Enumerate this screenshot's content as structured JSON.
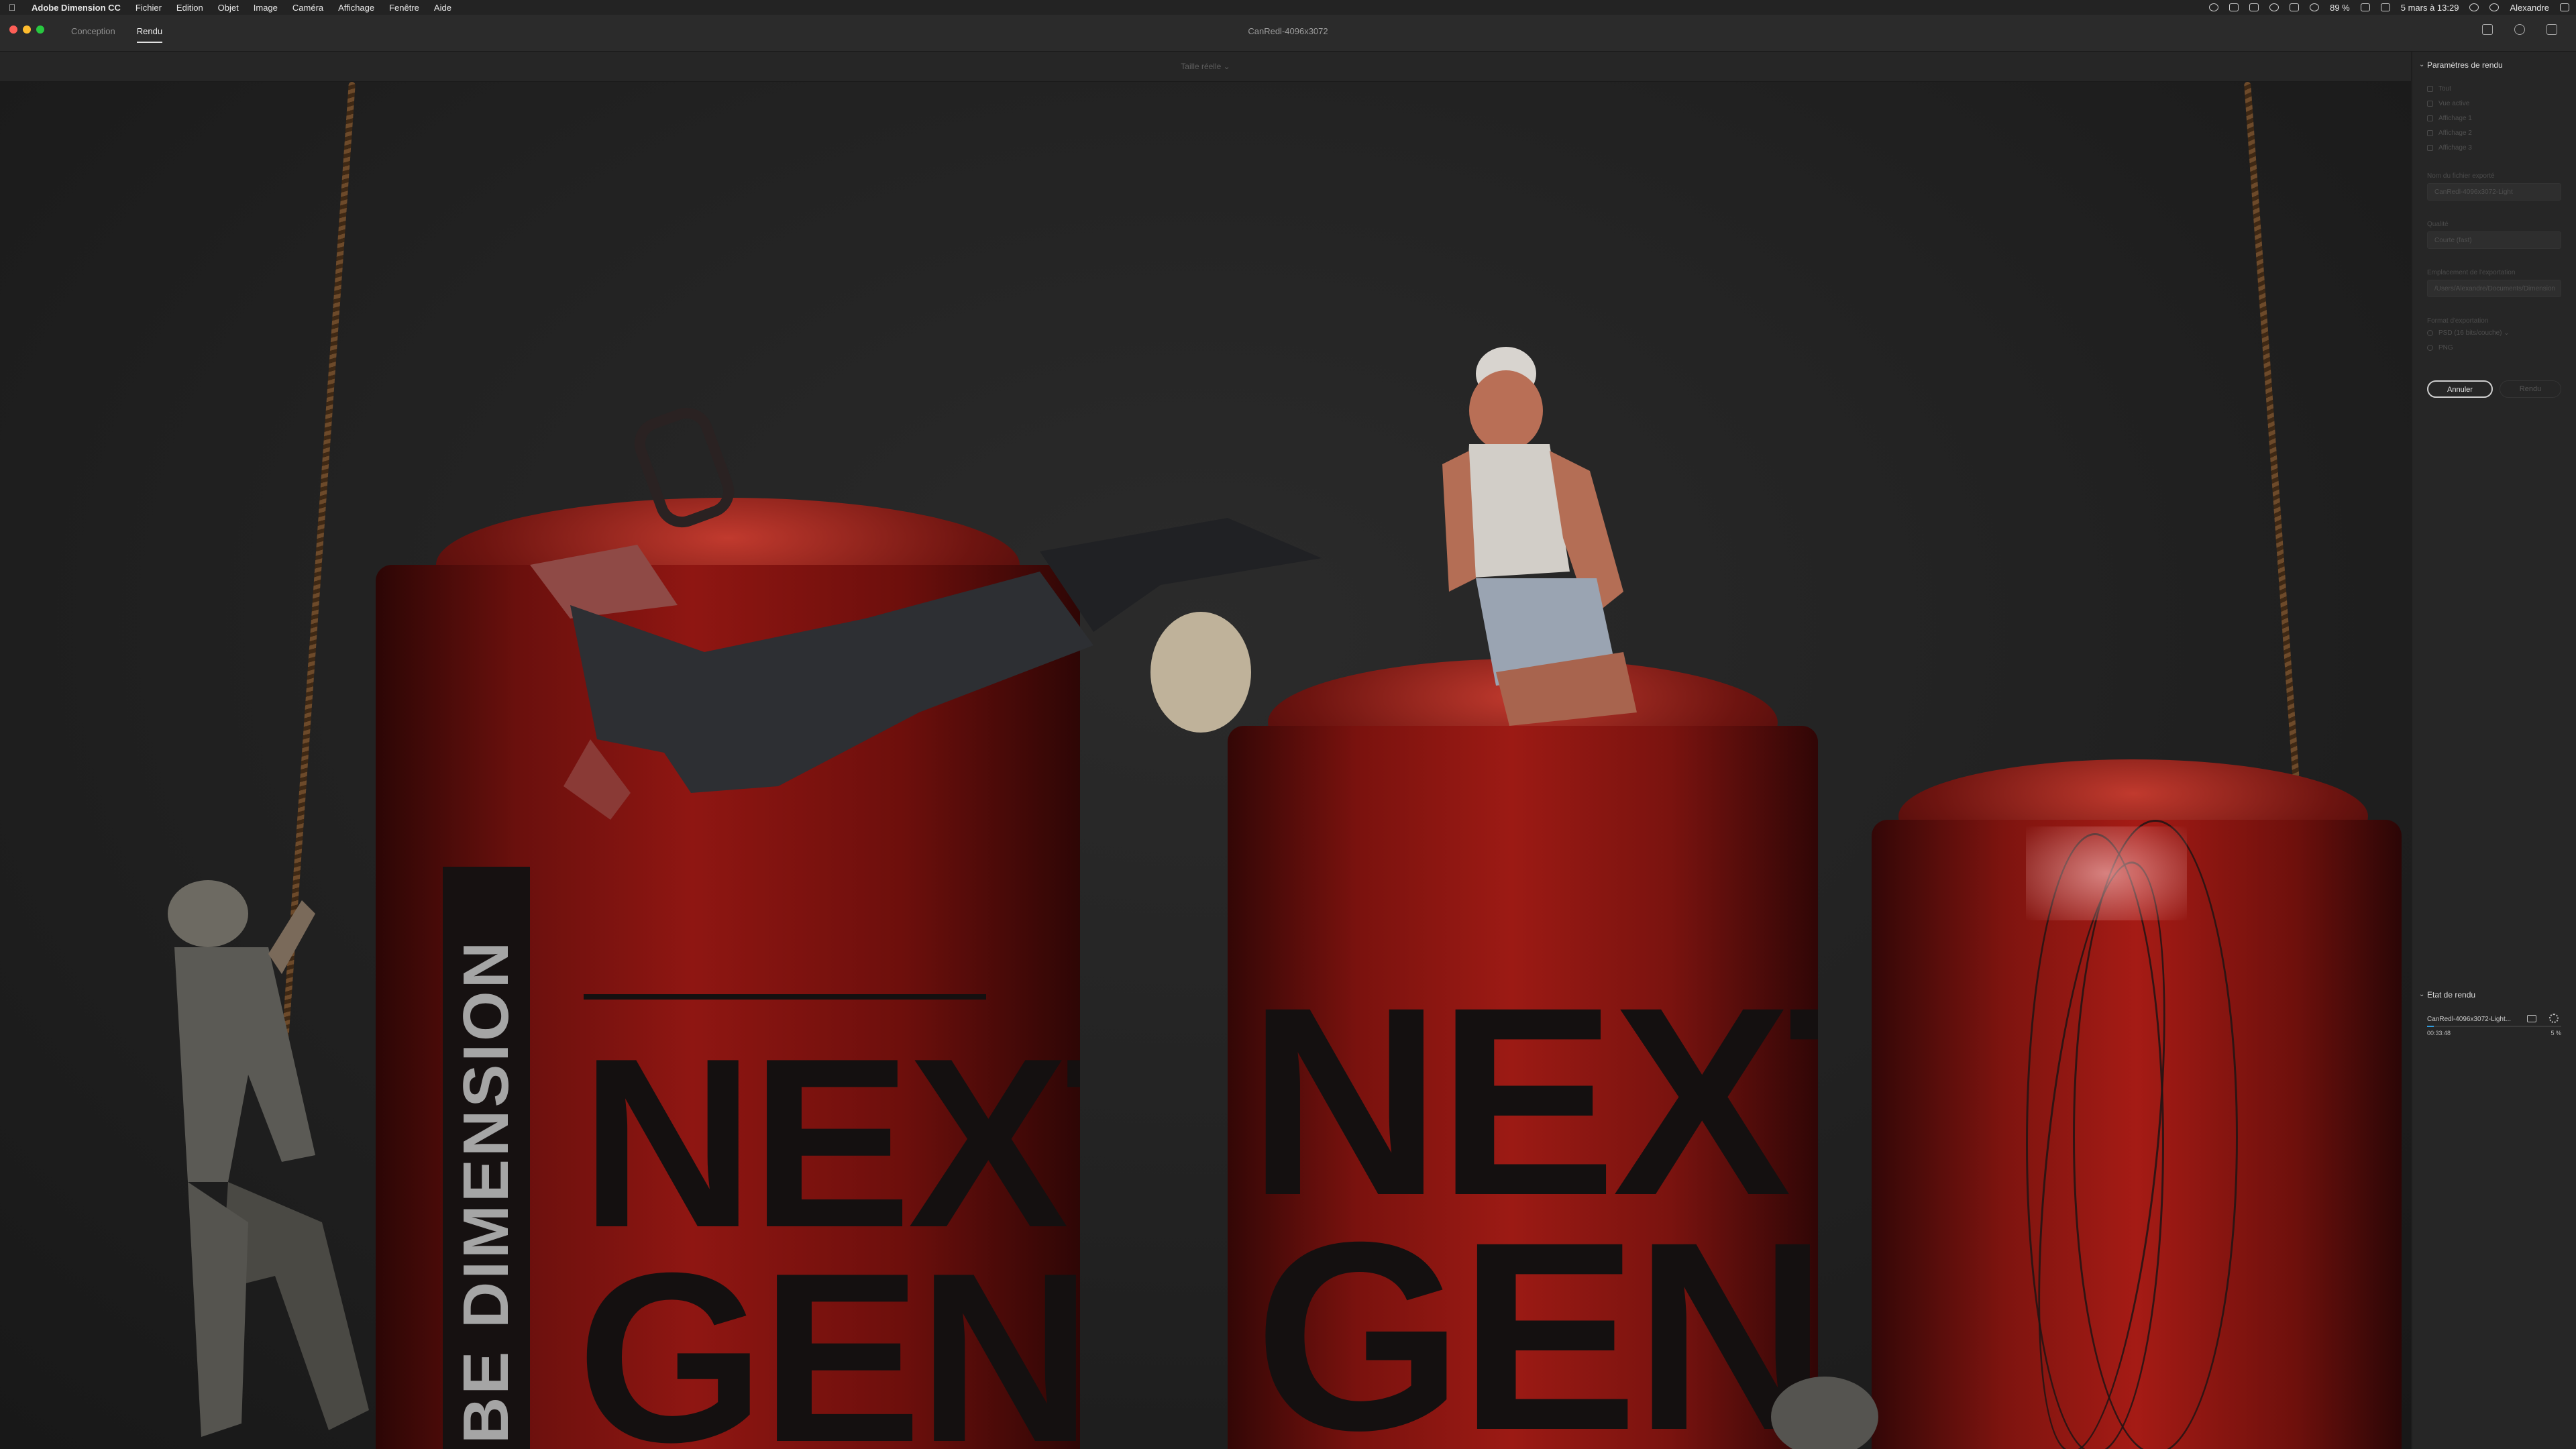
{
  "menubar": {
    "app_name": "Adobe Dimension CC",
    "items": [
      "Fichier",
      "Edition",
      "Objet",
      "Image",
      "Caméra",
      "Affichage",
      "Fenêtre",
      "Aide"
    ],
    "battery": "89 %",
    "datetime": "5 mars à 13:29",
    "user": "Alexandre"
  },
  "appbar": {
    "tabs": [
      "Conception",
      "Rendu"
    ],
    "active_tab": "Rendu",
    "doc_title": "CanRedl-4096x3072"
  },
  "viewbar": {
    "size_label": "Taille réelle ⌄"
  },
  "canvas": {
    "can1": {
      "side_text": "BE DIMENSION",
      "lines": [
        "NEXT",
        "GEN"
      ]
    },
    "can2": {
      "lines": [
        "NEXT",
        "GEN"
      ]
    }
  },
  "panel": {
    "render_settings": {
      "title": "Paramètres de rendu",
      "options": [
        "Tout",
        "Vue active",
        "Affichage 1",
        "Affichage 2",
        "Affichage 3"
      ],
      "file_label": "Nom du fichier exporté",
      "file_value": "CanRedl-4096x3072-Light",
      "quality_label": "Qualité",
      "quality_value": "Courte (fast)",
      "location_label": "Emplacement de l'exportation",
      "location_value": "/Users/Alexandre/Documents/Dimension",
      "format_label": "Format d'exportation",
      "format_value": "PSD (16 bits/couche) ⌄",
      "png_label": "PNG",
      "cancel": "Annuler",
      "render": "Rendu"
    },
    "render_status": {
      "title": "Etat de rendu",
      "file": "CanRedl-4096x3072-Light...",
      "time": "00:33:48",
      "percent": "5 %",
      "progress": 0.05
    }
  },
  "colors": {
    "accent": "#2f9bdd",
    "can_red": "#9c1a14",
    "panel_bg": "#262626"
  }
}
